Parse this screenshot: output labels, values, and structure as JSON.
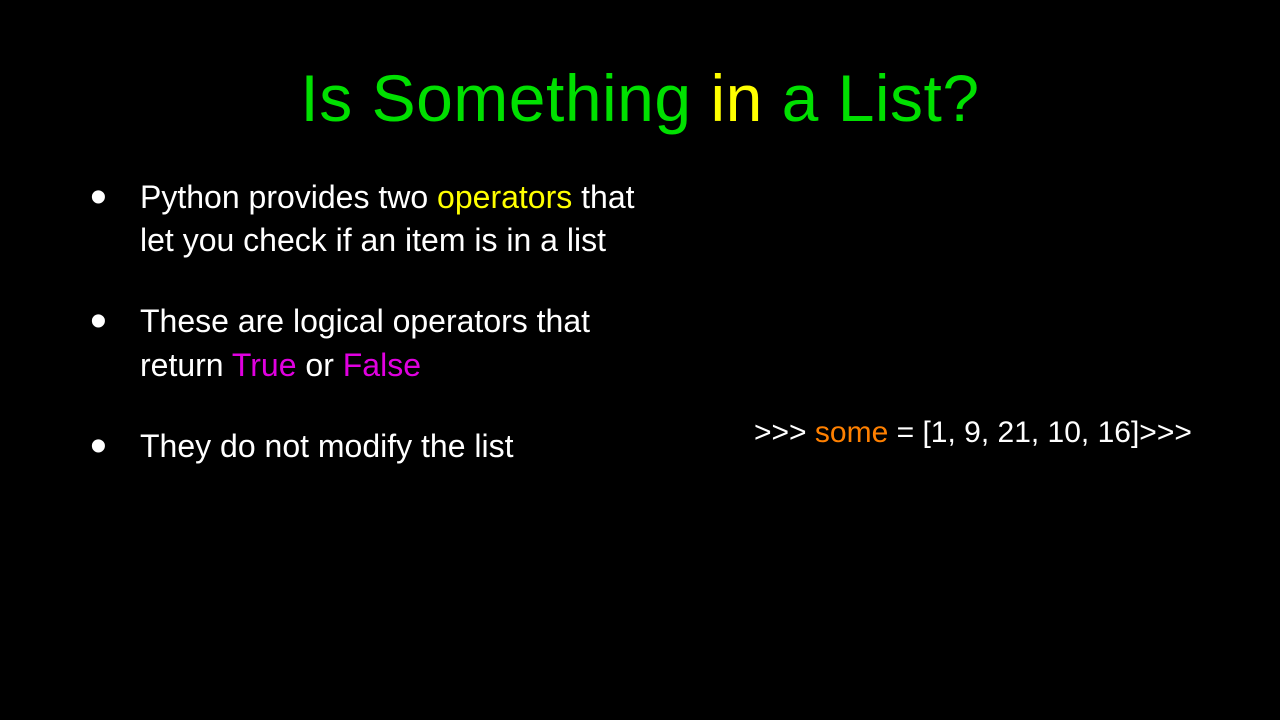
{
  "title": {
    "part1": "Is Something ",
    "part2": "in",
    "part3": " a List?"
  },
  "bullets": {
    "b1": {
      "t1": "Python provides two ",
      "op": "operators",
      "t2": " that let you check if an item is in a list"
    },
    "b2": {
      "t1": "These are logical operators that return ",
      "true": "True",
      "or": " or ",
      "false": "False"
    },
    "b3": {
      "t1": "They do not modify the list"
    }
  },
  "code": {
    "p1": ">>> ",
    "p2": "some",
    "p3": " = ",
    "p4": "[1, 9, 21, 10, 16]",
    "p5": ">>>"
  }
}
